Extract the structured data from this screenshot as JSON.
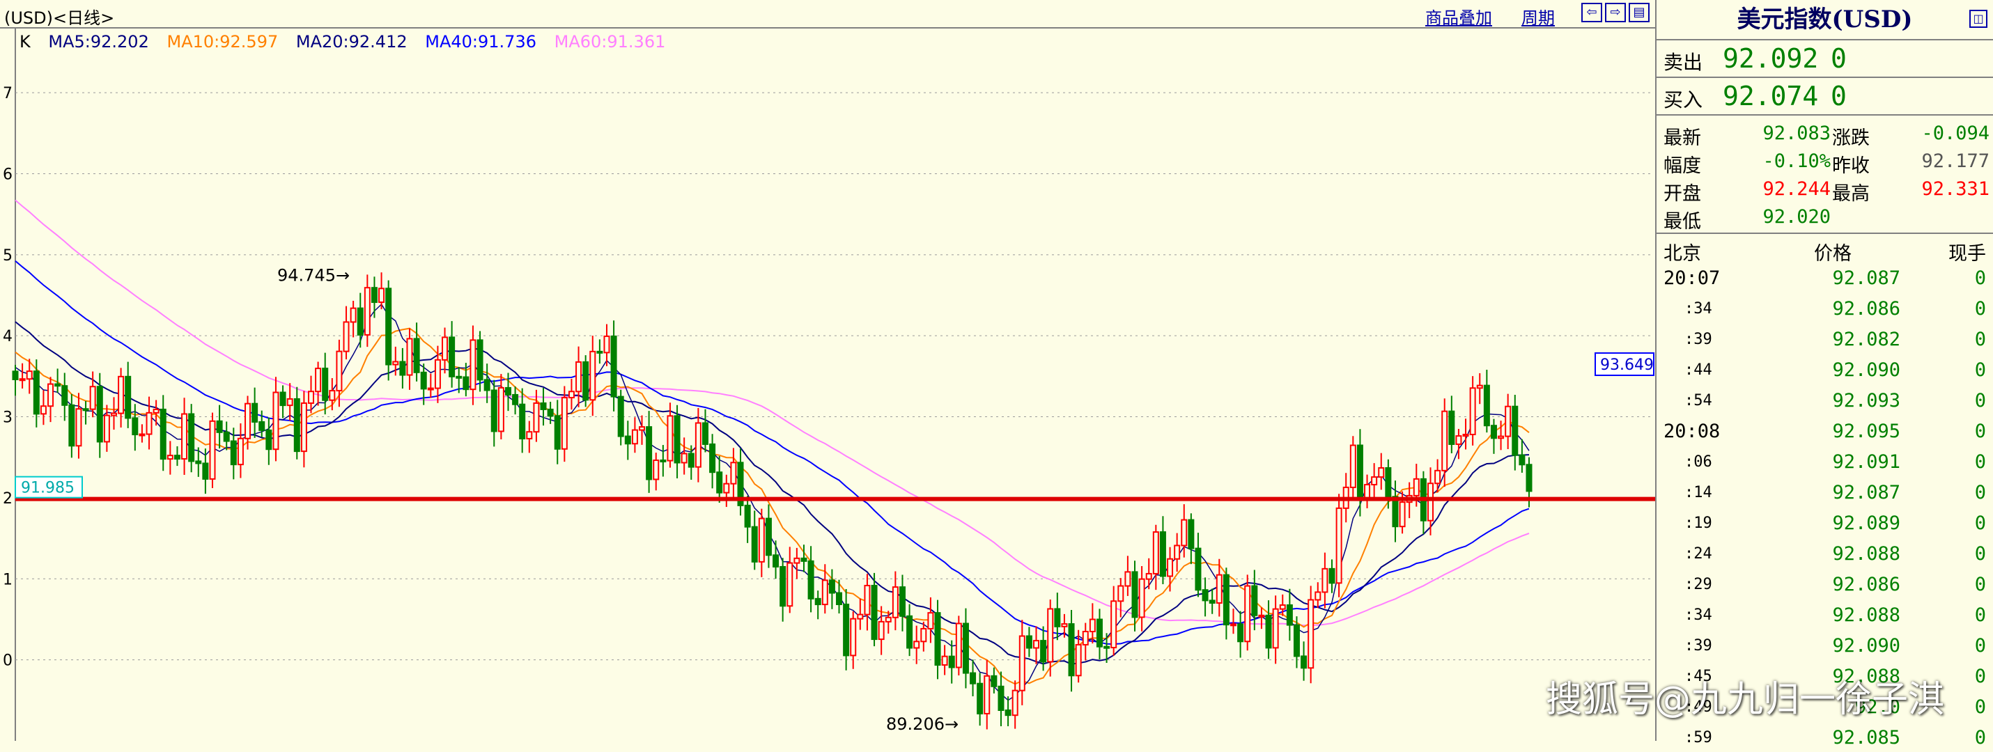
{
  "header": {
    "title": "(USD)<日线>",
    "overlay_link": "商品叠加",
    "period_link": "周期",
    "nav_icons": [
      "arrow-left-icon",
      "arrow-right-icon",
      "panel-toggle-icon"
    ]
  },
  "ma_legend": [
    {
      "label": "K",
      "color": "#000000"
    },
    {
      "label": "MA5:92.202",
      "color": "#000080"
    },
    {
      "label": "MA10:92.597",
      "color": "#ff8000"
    },
    {
      "label": "MA20:92.412",
      "color": "#000080"
    },
    {
      "label": "MA40:91.736",
      "color": "#0000ff"
    },
    {
      "label": "MA60:91.361",
      "color": "#ff80ff"
    }
  ],
  "colors": {
    "background": "#fdfde6",
    "up_candle": "#ff0000",
    "down_candle": "#008000",
    "support_line": "#dd0000",
    "ma5": "#000080",
    "ma10": "#ff8000",
    "ma20": "#000080",
    "ma40": "#0000ff",
    "ma60": "#ff80ff"
  },
  "chart_data": {
    "type": "candlestick",
    "title": "",
    "y_tick_labels": [
      "7",
      "6",
      "5",
      "4",
      "3",
      "2",
      "1",
      "0"
    ],
    "y_tick_values": [
      97,
      96,
      95,
      94,
      93,
      92,
      91,
      90
    ],
    "ylim": [
      89.0,
      97.8
    ],
    "grid": true,
    "annotations": {
      "high_label": "94.745",
      "high_value": 94.745,
      "low_label": "89.206",
      "low_value": 89.206,
      "current_price_label": "93.649",
      "current_price_value": 93.649,
      "support_label": "91.985",
      "support_value": 91.985
    },
    "series": [
      {
        "name": "MA5",
        "values": [
          92.202
        ]
      },
      {
        "name": "MA10",
        "values": [
          92.597
        ]
      },
      {
        "name": "MA20",
        "values": [
          92.412
        ]
      },
      {
        "name": "MA40",
        "values": [
          91.736
        ]
      },
      {
        "name": "MA60",
        "values": [
          91.361
        ]
      }
    ]
  },
  "panel": {
    "title": "美元指数(USD)",
    "sell_label": "卖出",
    "sell_price": "92.092",
    "sell_volume": "0",
    "buy_label": "买入",
    "buy_price": "92.074",
    "buy_volume": "0",
    "stats": [
      {
        "k1": "最新",
        "v1": "92.083",
        "c1": "green",
        "k2": "涨跌",
        "v2": "-0.094",
        "c2": "green"
      },
      {
        "k1": "幅度",
        "v1": "-0.10%",
        "c1": "green",
        "k2": "昨收",
        "v2": "92.177",
        "c2": "gray"
      },
      {
        "k1": "开盘",
        "v1": "92.244",
        "c1": "red",
        "k2": "最高",
        "v2": "92.331",
        "c2": "red"
      },
      {
        "k1": "最低",
        "v1": "92.020",
        "c1": "green",
        "k2": "",
        "v2": "",
        "c2": "gray"
      }
    ],
    "ticks_header": {
      "time": "北京",
      "price": "价格",
      "volume": "现手"
    },
    "ticks": [
      {
        "time": "20:07",
        "price": "92.087",
        "volume": "0",
        "sub": false
      },
      {
        "time": ":34",
        "price": "92.086",
        "volume": "0",
        "sub": true
      },
      {
        "time": ":39",
        "price": "92.082",
        "volume": "0",
        "sub": true
      },
      {
        "time": ":44",
        "price": "92.090",
        "volume": "0",
        "sub": true
      },
      {
        "time": ":54",
        "price": "92.093",
        "volume": "0",
        "sub": true
      },
      {
        "time": "20:08",
        "price": "92.095",
        "volume": "0",
        "sub": false
      },
      {
        "time": ":06",
        "price": "92.091",
        "volume": "0",
        "sub": true
      },
      {
        "time": ":14",
        "price": "92.087",
        "volume": "0",
        "sub": true
      },
      {
        "time": ":19",
        "price": "92.089",
        "volume": "0",
        "sub": true
      },
      {
        "time": ":24",
        "price": "92.088",
        "volume": "0",
        "sub": true
      },
      {
        "time": ":29",
        "price": "92.086",
        "volume": "0",
        "sub": true
      },
      {
        "time": ":34",
        "price": "92.088",
        "volume": "0",
        "sub": true
      },
      {
        "time": ":39",
        "price": "92.090",
        "volume": "0",
        "sub": true
      },
      {
        "time": ":45",
        "price": "92.088",
        "volume": "0",
        "sub": true
      },
      {
        "time": ":49",
        "price": "92.0",
        "volume": "0",
        "sub": true
      },
      {
        "time": ":59",
        "price": "92.085",
        "volume": "0",
        "sub": true
      }
    ]
  },
  "watermark": "搜狐号@九九归一徐子淇"
}
